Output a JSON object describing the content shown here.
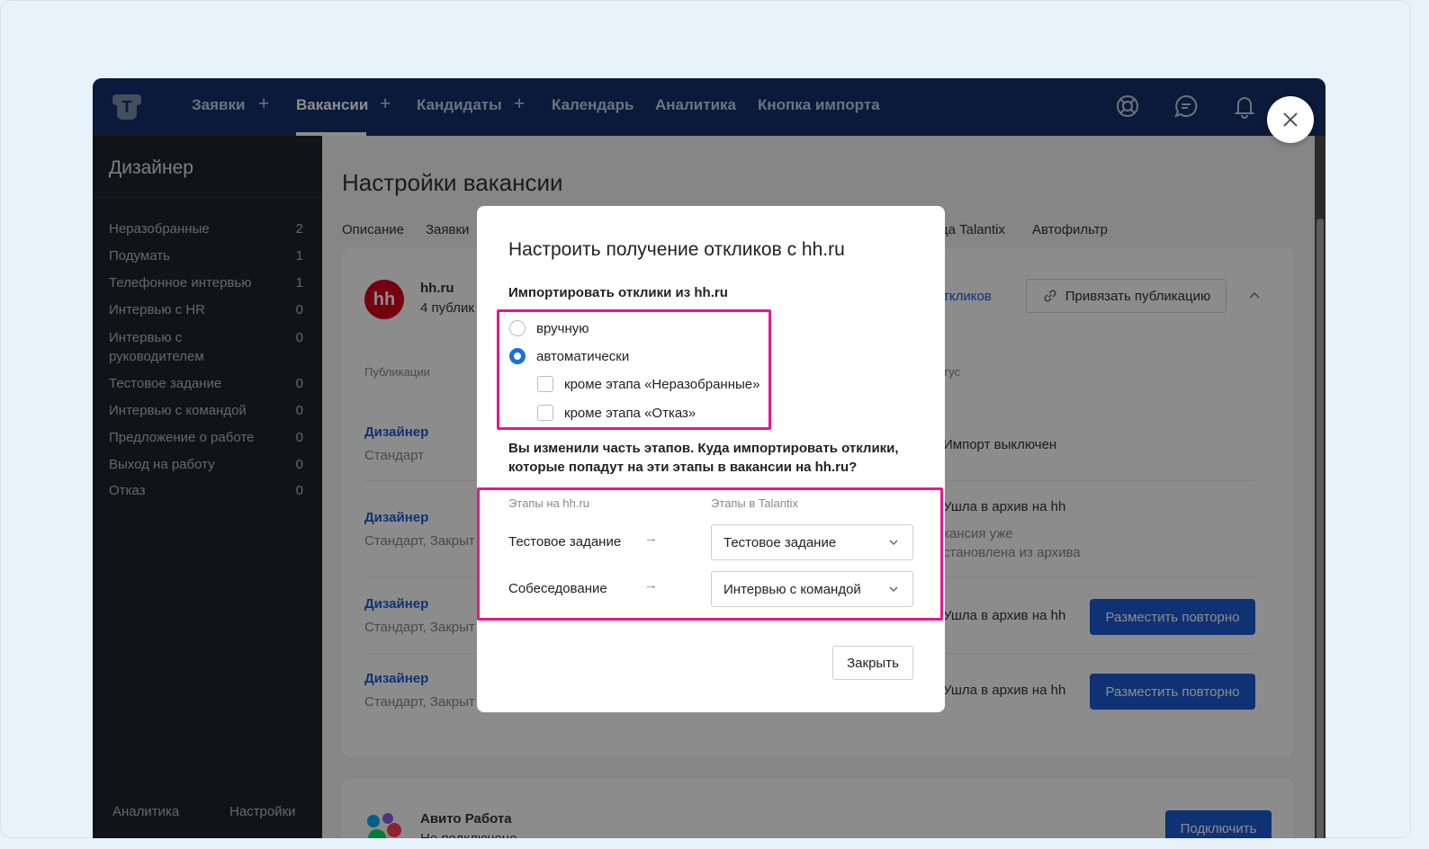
{
  "nav": {
    "items": [
      {
        "label": "Заявки",
        "plus": "+"
      },
      {
        "label": "Вакансии",
        "plus": "+"
      },
      {
        "label": "Кандидаты",
        "plus": "+"
      },
      {
        "label": "Календарь"
      },
      {
        "label": "Аналитика"
      },
      {
        "label": "Кнопка импорта"
      }
    ],
    "active": "Вакансии",
    "logo_letter": "T"
  },
  "sidebar": {
    "title": "Дизайнер",
    "stages": [
      {
        "label": "Неразобранные",
        "count": "2"
      },
      {
        "label": "Подумать",
        "count": "1"
      },
      {
        "label": "Телефонное интервью",
        "count": "1"
      },
      {
        "label": "Интервью с HR",
        "count": "0"
      },
      {
        "label": "Интервью с руководителем",
        "count": "0"
      },
      {
        "label": "Тестовое задание",
        "count": "0"
      },
      {
        "label": "Интервью с командой",
        "count": "0"
      },
      {
        "label": "Предложение о работе",
        "count": "0"
      },
      {
        "label": "Выход на работу",
        "count": "0"
      },
      {
        "label": "Отказ",
        "count": "0"
      }
    ],
    "bottom_left": "Аналитика",
    "bottom_right": "Настройки"
  },
  "main": {
    "title": "Настройки вакансии",
    "tabs": [
      "Описание",
      "Заявки",
      "ца Talantix",
      "Автофильтр"
    ],
    "hh": {
      "logo": "hh",
      "name": "hh.ru",
      "pubs": "4 публик",
      "link_responses": "тклико­в",
      "bind_button": "Привязать публикацию",
      "col_pubs": "Публикации",
      "col_status": "тус"
    },
    "rows": [
      {
        "title": "Дизайнер",
        "sub": "Стандарт",
        "status": "Импорт выключен",
        "status2": "",
        "status3": ""
      },
      {
        "title": "Дизайнер",
        "sub": "Стандарт, Закрыт",
        "status": "Ушла в архив на hh",
        "status2": "кансия уже",
        "status3": "становлена из архива"
      },
      {
        "title": "Дизайнер",
        "sub": "Стандарт, Закрыт",
        "status": "Ушла в архив на hh",
        "button": "Разместить повторно"
      },
      {
        "title": "Дизайнер",
        "sub": "Стандарт, Закрыт",
        "status": "Ушла в архив на hh",
        "button": "Разместить повторно"
      }
    ],
    "avito": {
      "name": "Авито Работа",
      "sub": "Не подключено",
      "button": "Подключить"
    }
  },
  "modal": {
    "title": "Настроить получение откликов с hh.ru",
    "import_label": "Импортировать отклики из hh.ru",
    "options": {
      "manual": "вручную",
      "auto": "автоматически",
      "except_unsorted": "кроме этапа «Неразобранные»",
      "except_reject": "кроме этапа «Отказ»"
    },
    "selected": "автоматически",
    "note": "Вы изменили часть этапов. Куда импортировать отклики, которые попадут на эти этапы в вакансии на hh.ru?",
    "col_hh": "Этапы на hh.ru",
    "col_talantix": "Этапы в Talantix",
    "mappings": [
      {
        "hh_stage": "Тестовое задание",
        "talantix_stage": "Тестовое задание"
      },
      {
        "hh_stage": "Собеседование",
        "talantix_stage": "Интервью с командой"
      }
    ],
    "close_button": "Закрыть"
  },
  "colors": {
    "nav_bg": "#15316b",
    "accent": "#1d5bd6",
    "highlight": "#e5198a",
    "hh_red": "#d6001c"
  }
}
